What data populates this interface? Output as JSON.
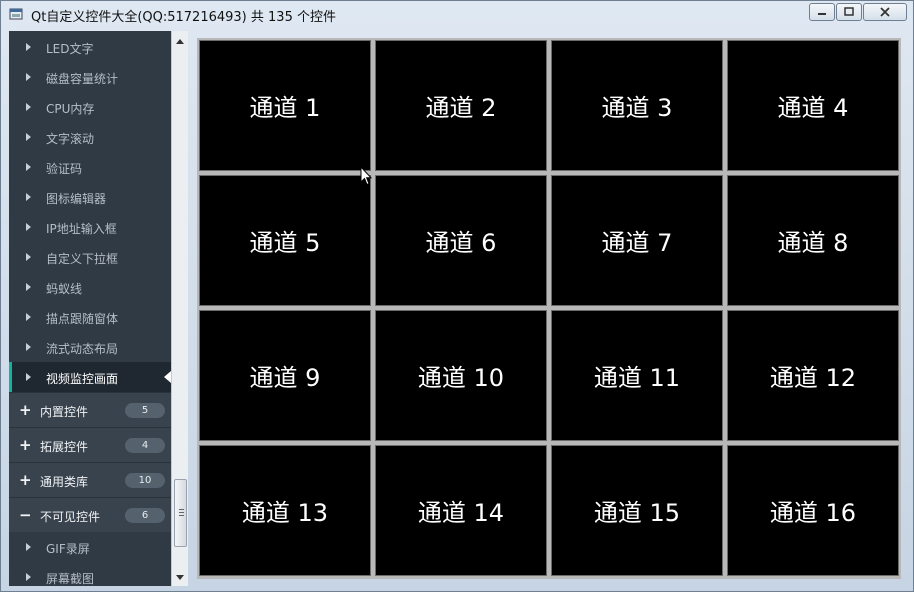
{
  "window": {
    "title": "Qt自定义控件大全(QQ:517216493) 共 135 个控件",
    "icon": "app-window-icon",
    "controls": [
      "minimize",
      "maximize",
      "close"
    ]
  },
  "sidebar": {
    "items_top": [
      {
        "label": "LED文字"
      },
      {
        "label": "磁盘容量统计"
      },
      {
        "label": "CPU内存"
      },
      {
        "label": "文字滚动"
      },
      {
        "label": "验证码"
      },
      {
        "label": "图标编辑器"
      },
      {
        "label": "IP地址输入框"
      },
      {
        "label": "自定义下拉框"
      },
      {
        "label": "蚂蚁线"
      },
      {
        "label": "描点跟随窗体"
      },
      {
        "label": "流式动态布局"
      },
      {
        "label": "视频监控画面",
        "active": true
      }
    ],
    "groups": [
      {
        "sign": "+",
        "label": "内置控件",
        "count": "5"
      },
      {
        "sign": "+",
        "label": "拓展控件",
        "count": "4"
      },
      {
        "sign": "+",
        "label": "通用类库",
        "count": "10"
      },
      {
        "sign": "−",
        "label": "不可见控件",
        "count": "6"
      }
    ],
    "items_bottom": [
      {
        "label": "GIF录屏"
      },
      {
        "label": "屏幕截图"
      }
    ]
  },
  "video_grid": {
    "channels": [
      "通道 1",
      "通道 2",
      "通道 3",
      "通道 4",
      "通道 5",
      "通道 6",
      "通道 7",
      "通道 8",
      "通道 9",
      "通道 10",
      "通道 11",
      "通道 12",
      "通道 13",
      "通道 14",
      "通道 15",
      "通道 16"
    ]
  },
  "colors": {
    "sidebar_bg": "#2f3a45",
    "active_accent": "#14b3a0",
    "cell_bg": "#000000",
    "cell_text": "#ffffff"
  }
}
